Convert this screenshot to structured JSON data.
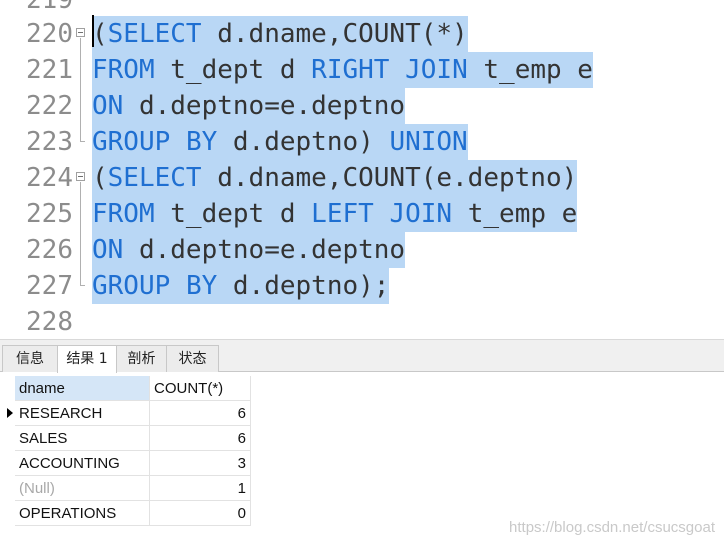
{
  "editor": {
    "partial_top_line": "219",
    "lines": [
      {
        "no": "220",
        "tokens": [
          {
            "t": "(",
            "k": 0
          },
          {
            "t": "SELECT",
            "k": 1
          },
          {
            "t": " d.dname,COUNT(*)",
            "k": 0
          }
        ]
      },
      {
        "no": "221",
        "tokens": [
          {
            "t": "FROM",
            "k": 1
          },
          {
            "t": " t_dept d ",
            "k": 0
          },
          {
            "t": "RIGHT",
            "k": 1
          },
          {
            "t": " ",
            "k": 0
          },
          {
            "t": "JOIN",
            "k": 1
          },
          {
            "t": " t_emp e",
            "k": 0
          }
        ]
      },
      {
        "no": "222",
        "tokens": [
          {
            "t": "ON",
            "k": 1
          },
          {
            "t": " d.deptno=e.deptno",
            "k": 0
          }
        ]
      },
      {
        "no": "223",
        "tokens": [
          {
            "t": "GROUP",
            "k": 1
          },
          {
            "t": " ",
            "k": 0
          },
          {
            "t": "BY",
            "k": 1
          },
          {
            "t": " d.deptno) ",
            "k": 0
          },
          {
            "t": "UNION",
            "k": 1
          }
        ]
      },
      {
        "no": "224",
        "tokens": [
          {
            "t": "(",
            "k": 0
          },
          {
            "t": "SELECT",
            "k": 1
          },
          {
            "t": " d.dname,COUNT(e.deptno)",
            "k": 0
          }
        ]
      },
      {
        "no": "225",
        "tokens": [
          {
            "t": "FROM",
            "k": 1
          },
          {
            "t": " t_dept d ",
            "k": 0
          },
          {
            "t": "LEFT",
            "k": 1
          },
          {
            "t": " ",
            "k": 0
          },
          {
            "t": "JOIN",
            "k": 1
          },
          {
            "t": " t_emp e",
            "k": 0
          }
        ]
      },
      {
        "no": "226",
        "tokens": [
          {
            "t": "ON",
            "k": 1
          },
          {
            "t": " d.deptno=e.deptno",
            "k": 0
          }
        ]
      },
      {
        "no": "227",
        "tokens": [
          {
            "t": "GROUP",
            "k": 1
          },
          {
            "t": " ",
            "k": 0
          },
          {
            "t": "BY",
            "k": 1
          },
          {
            "t": " d.deptno);",
            "k": 0
          }
        ]
      },
      {
        "no": "228",
        "tokens": []
      }
    ]
  },
  "tabs": [
    "信息",
    "结果 1",
    "剖析",
    "状态"
  ],
  "active_tab": "结果 1",
  "results": {
    "columns": [
      "dname",
      "COUNT(*)"
    ],
    "rows": [
      {
        "dname": "RESEARCH",
        "count": "6",
        "current": true
      },
      {
        "dname": "SALES",
        "count": "6"
      },
      {
        "dname": "ACCOUNTING",
        "count": "3"
      },
      {
        "dname": "(Null)",
        "count": "1",
        "null": true
      },
      {
        "dname": "OPERATIONS",
        "count": "0"
      }
    ]
  },
  "watermark": "https://blog.csdn.net/csucsgoat",
  "colors": {
    "keyword": "#1f6fd1",
    "selection": "#b9d7f5",
    "line_number": "#8c8c8c",
    "header_highlight": "#d5e6f7"
  }
}
